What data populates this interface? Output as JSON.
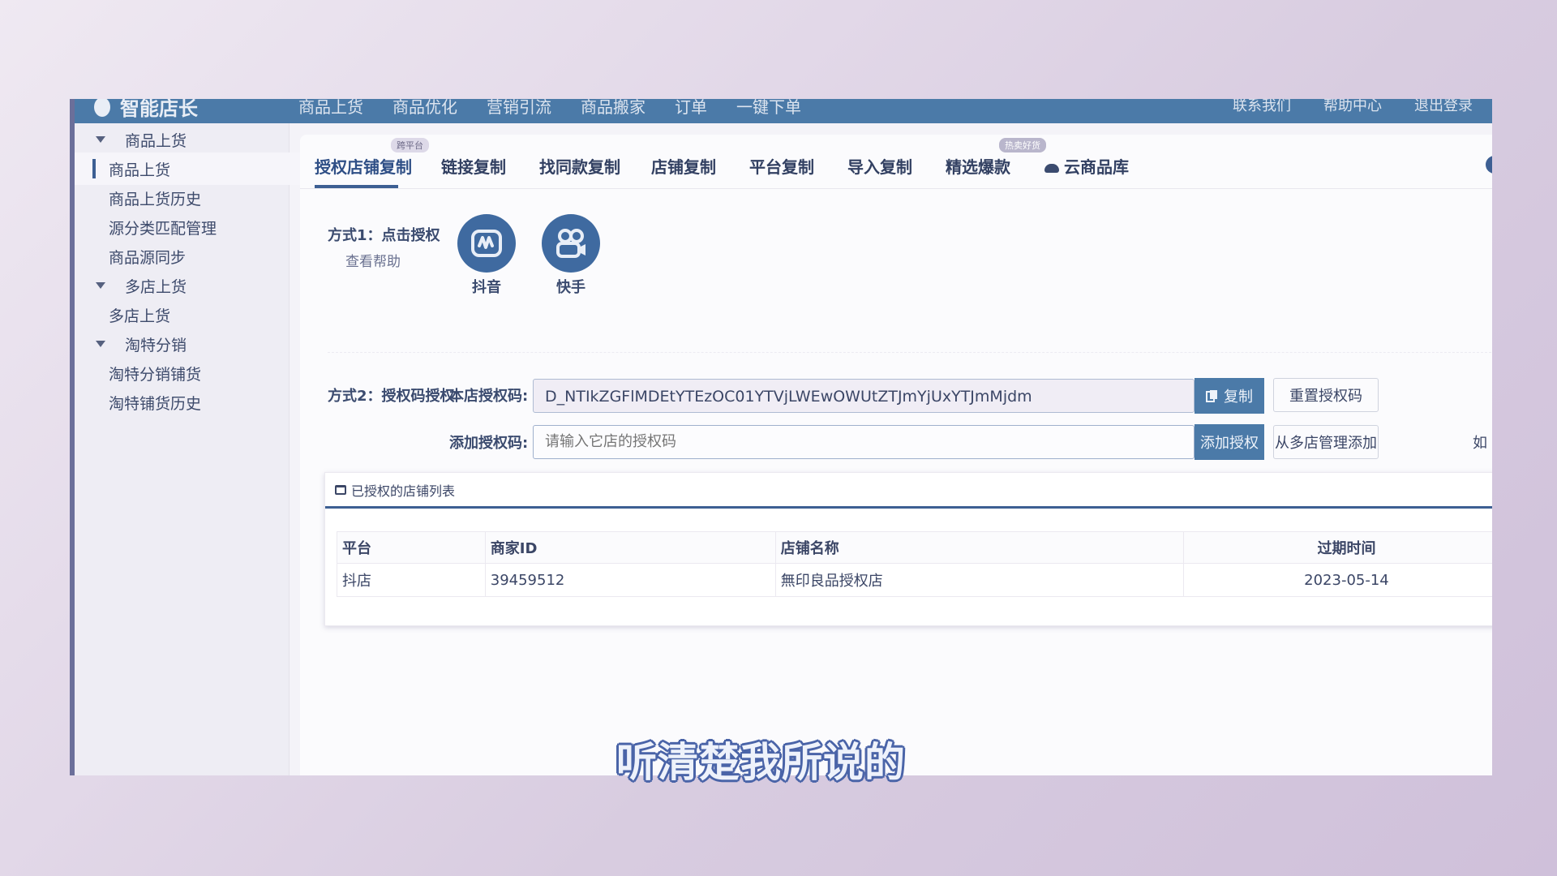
{
  "topbar": {
    "brand": "智能店长",
    "nav": [
      "商品上货",
      "商品优化",
      "营销引流",
      "商品搬家",
      "订单",
      "一键下单"
    ],
    "right": [
      "联系我们",
      "帮助中心",
      "退出登录"
    ]
  },
  "sidebar": {
    "groups": [
      {
        "label": "商品上货",
        "items": [
          "商品上货",
          "商品上货历史",
          "源分类匹配管理",
          "商品源同步"
        ]
      },
      {
        "label": "多店上货",
        "items": [
          "多店上货"
        ]
      },
      {
        "label": "淘特分销",
        "items": [
          "淘特分销铺货",
          "淘特铺货历史"
        ]
      }
    ],
    "active": "商品上货"
  },
  "tabs": {
    "items": [
      "授权店铺复制",
      "链接复制",
      "找同款复制",
      "店铺复制",
      "平台复制",
      "导入复制",
      "精选爆款",
      "云商品库"
    ],
    "badge_cross_platform": "跨平台",
    "badge_hot": "热卖好货",
    "info": "1"
  },
  "method1": {
    "title": "方式1：点击授权",
    "help": "查看帮助",
    "platforms": [
      {
        "name": "抖音",
        "icon": "douyin-icon"
      },
      {
        "name": "快手",
        "icon": "kuaishou-icon"
      }
    ]
  },
  "method2": {
    "title": "方式2：授权码授权",
    "own_code_label": "本店授权码:",
    "own_code_value": "D_NTIkZGFlMDEtYTEzOC01YTVjLWEwOWUtZTJmYjUxYTJmMjdm",
    "copy_button": "复制",
    "reset_button": "重置授权码",
    "add_code_label": "添加授权码:",
    "add_code_placeholder": "请输入它店的授权码",
    "add_button": "添加授权",
    "multi_store_button": "从多店管理添加",
    "cut_text": "如"
  },
  "authorized_list": {
    "title": "已授权的店铺列表",
    "columns": [
      "平台",
      "商家ID",
      "店铺名称",
      "过期时间"
    ],
    "rows": [
      {
        "platform": "抖店",
        "merchant_id": "39459512",
        "store_name": "無印良品授权店",
        "expiry": "2023-05-14"
      }
    ]
  },
  "caption": "听清楚我所说的",
  "colors": {
    "primary": "#4b7aa8",
    "accent_dark": "#3d5f93",
    "background": "#d8cce0"
  }
}
